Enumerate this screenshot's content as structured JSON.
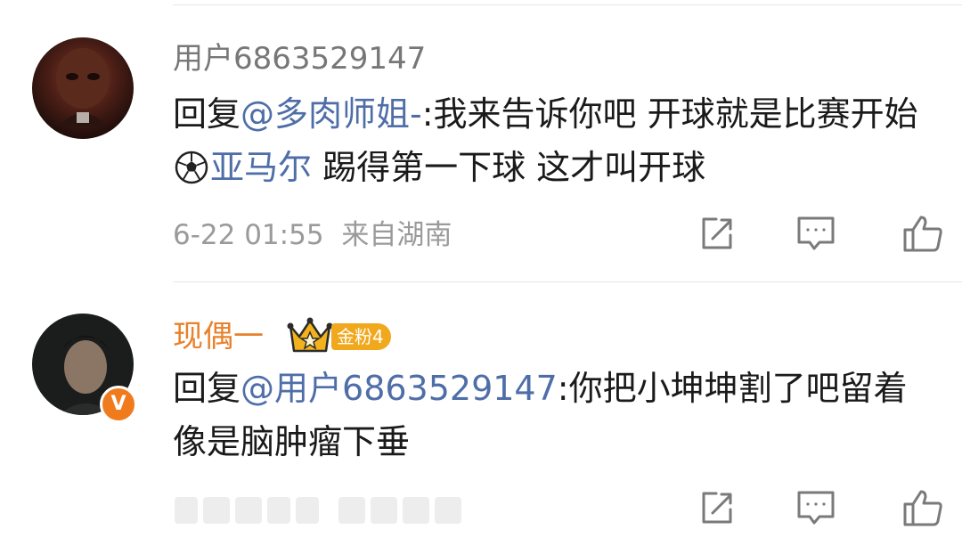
{
  "comments": [
    {
      "author": "用户6863529147",
      "reply_prefix": "回复",
      "mention": "@多肉师姐-",
      "text_part1": ":我来告诉你吧 开球就是比赛开始",
      "topic_icon": "soccer-ball-icon",
      "topic": "亚马尔",
      "text_part2": " 踢得第一下球 这才叫开球",
      "time": "6-22 01:55",
      "location": "来自湖南"
    },
    {
      "author": "现偶一",
      "author_color": "#e8812b",
      "badge_label": "金粉4",
      "badge_color": "#f0a81d",
      "verified_label": "V",
      "reply_prefix": "回复",
      "mention": "@用户6863529147",
      "text": ":你把小坤坤割了吧留着像是脑肿瘤下垂"
    }
  ],
  "icons": {
    "share": "share-icon",
    "comment": "comment-icon",
    "like": "like-icon"
  },
  "colors": {
    "mention": "#4f6ea8",
    "meta": "#9a9a9a",
    "text": "#1a1a1a"
  }
}
